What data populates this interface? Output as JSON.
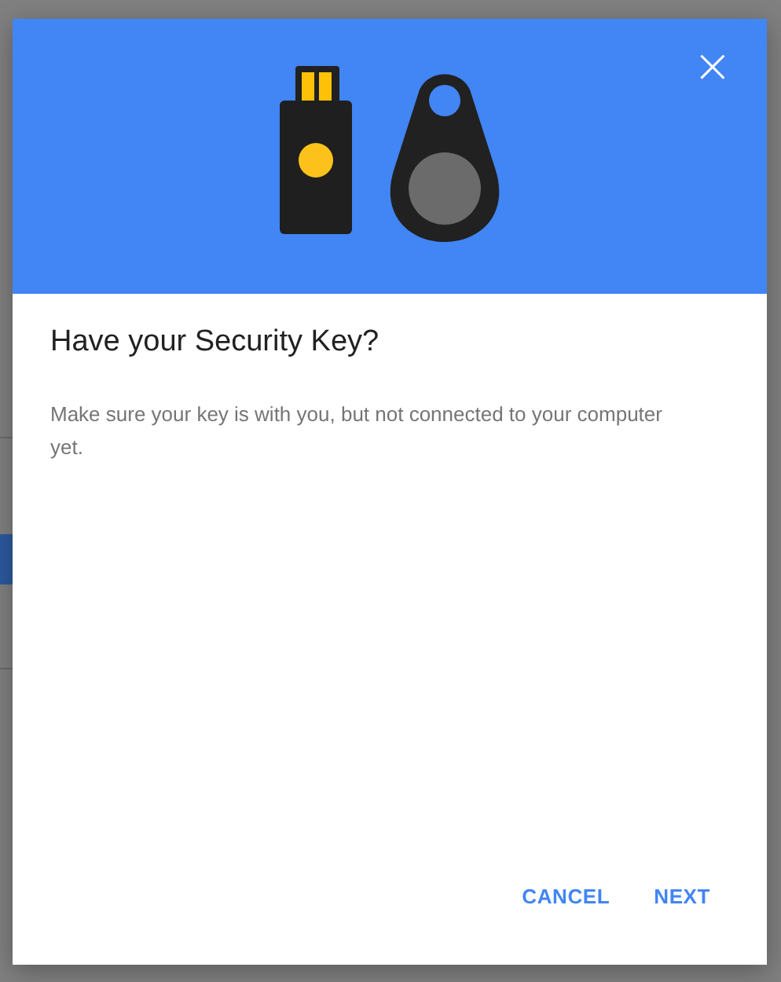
{
  "dialog": {
    "close_label": "×",
    "title": "Have your Security Key?",
    "message": "Make sure your key is with you, but not connected to your computer yet.",
    "buttons": [
      "CANCEL",
      "NEXT"
    ]
  }
}
